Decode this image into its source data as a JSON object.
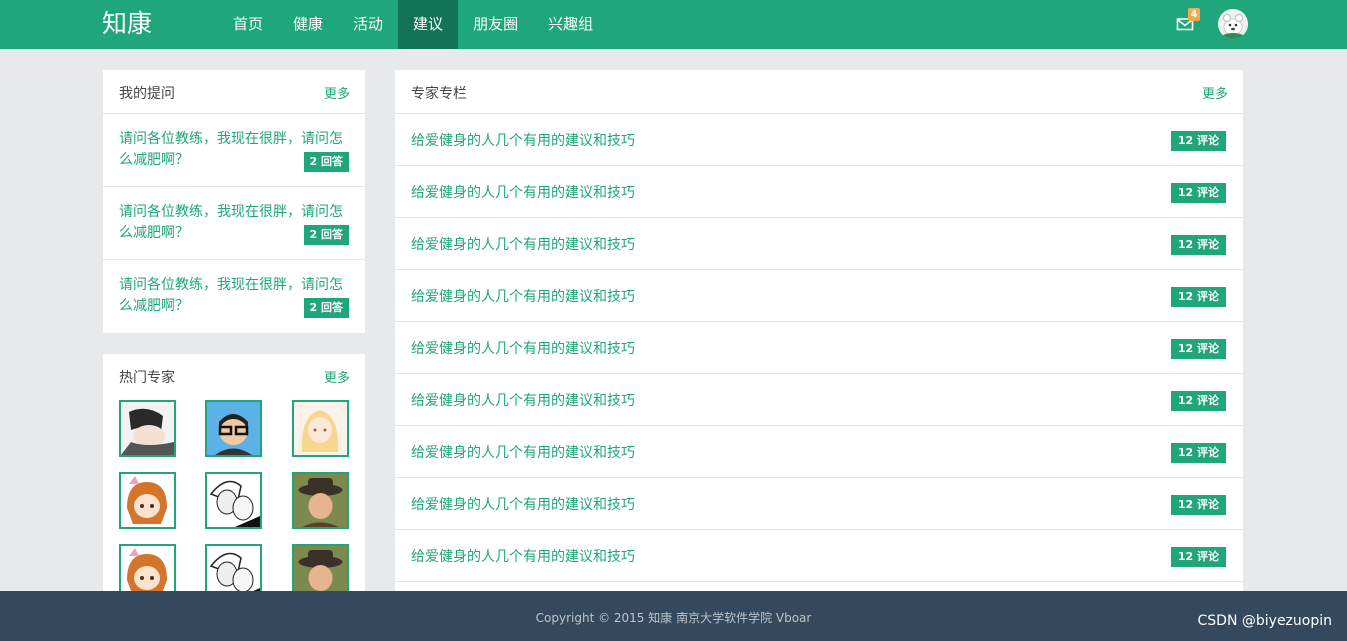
{
  "header": {
    "brand": "知康",
    "nav": [
      {
        "label": "首页",
        "active": false
      },
      {
        "label": "健康",
        "active": false
      },
      {
        "label": "活动",
        "active": false
      },
      {
        "label": "建议",
        "active": true
      },
      {
        "label": "朋友圈",
        "active": false
      },
      {
        "label": "兴趣组",
        "active": false
      }
    ],
    "mail_badge": "4",
    "mail_icon": "envelope-icon",
    "avatar_icon": "user-avatar"
  },
  "questions": {
    "title": "我的提问",
    "more": "更多",
    "items": [
      {
        "text": "请问各位教练，我现在很胖，请问怎么减肥啊？",
        "badge": "2 回答"
      },
      {
        "text": "请问各位教练，我现在很胖，请问怎么减肥啊？",
        "badge": "2 回答"
      },
      {
        "text": "请问各位教练，我现在很胖，请问怎么减肥啊？",
        "badge": "2 回答"
      }
    ]
  },
  "experts": {
    "title": "热门专家",
    "more": "更多",
    "avatars": [
      "expert-avatar-1",
      "expert-avatar-2",
      "expert-avatar-3",
      "expert-avatar-4",
      "expert-avatar-5",
      "expert-avatar-6",
      "expert-avatar-7",
      "expert-avatar-8",
      "expert-avatar-9"
    ]
  },
  "column": {
    "title": "专家专栏",
    "more": "更多",
    "items": [
      {
        "text": "给爱健身的人几个有用的建议和技巧",
        "badge": "12 评论"
      },
      {
        "text": "给爱健身的人几个有用的建议和技巧",
        "badge": "12 评论"
      },
      {
        "text": "给爱健身的人几个有用的建议和技巧",
        "badge": "12 评论"
      },
      {
        "text": "给爱健身的人几个有用的建议和技巧",
        "badge": "12 评论"
      },
      {
        "text": "给爱健身的人几个有用的建议和技巧",
        "badge": "12 评论"
      },
      {
        "text": "给爱健身的人几个有用的建议和技巧",
        "badge": "12 评论"
      },
      {
        "text": "给爱健身的人几个有用的建议和技巧",
        "badge": "12 评论"
      },
      {
        "text": "给爱健身的人几个有用的建议和技巧",
        "badge": "12 评论"
      },
      {
        "text": "给爱健身的人几个有用的建议和技巧",
        "badge": "12 评论"
      }
    ]
  },
  "footer": {
    "copyright": "Copyright © 2015 知康 南京大学软件学院 Vboar",
    "watermark": "CSDN @biyezuopin"
  },
  "colors": {
    "primary": "#1fa67a",
    "nav_active": "#137355",
    "footer_bg": "#34495e",
    "badge_orange": "#f0ad4e"
  }
}
